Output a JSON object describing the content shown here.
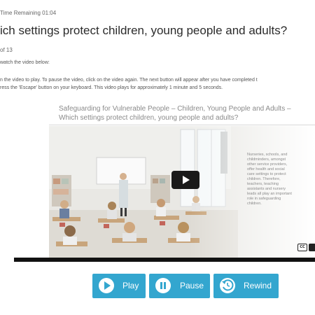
{
  "header": {
    "timer": "Time Remaining 01:04",
    "title": "ich settings protect children, young people and adults?",
    "counter": "of 13"
  },
  "instructions": {
    "lead": "watch the video below:",
    "line1": "n the video to play. To pause the video, click on the video again. The next button will appear after you have completed t",
    "line2": "ress the 'Escape' button on your keyboard. This video plays for approximately 1 minute and 5 seconds."
  },
  "video": {
    "title_line1": "Safeguarding for Vulnerable People – Children, Young People and Adults –",
    "title_line2": "Which settings protect children, young people and adults?",
    "caption_lines": [
      "Nurseries, schools, and",
      "childminders, amongst",
      "other service providers,",
      "offer health and social",
      "care settings to protect",
      "children. Therefore,",
      "teachers, teaching",
      "assistants and nursery",
      "leads all play an important",
      "role in safeguarding",
      "children."
    ],
    "cc_label": "CC"
  },
  "controls": {
    "play_label": "Play",
    "pause_label": "Pause",
    "rewind_label": "Rewind"
  }
}
